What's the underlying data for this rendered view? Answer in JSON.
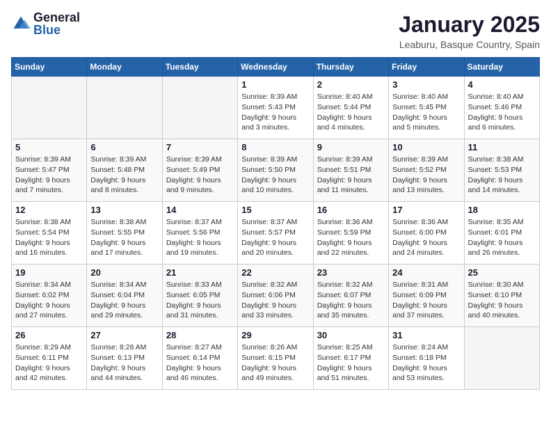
{
  "logo": {
    "general": "General",
    "blue": "Blue"
  },
  "title": "January 2025",
  "subtitle": "Leaburu, Basque Country, Spain",
  "weekdays": [
    "Sunday",
    "Monday",
    "Tuesday",
    "Wednesday",
    "Thursday",
    "Friday",
    "Saturday"
  ],
  "weeks": [
    [
      {
        "day": "",
        "info": ""
      },
      {
        "day": "",
        "info": ""
      },
      {
        "day": "",
        "info": ""
      },
      {
        "day": "1",
        "info": "Sunrise: 8:39 AM\nSunset: 5:43 PM\nDaylight: 9 hours and 3 minutes."
      },
      {
        "day": "2",
        "info": "Sunrise: 8:40 AM\nSunset: 5:44 PM\nDaylight: 9 hours and 4 minutes."
      },
      {
        "day": "3",
        "info": "Sunrise: 8:40 AM\nSunset: 5:45 PM\nDaylight: 9 hours and 5 minutes."
      },
      {
        "day": "4",
        "info": "Sunrise: 8:40 AM\nSunset: 5:46 PM\nDaylight: 9 hours and 6 minutes."
      }
    ],
    [
      {
        "day": "5",
        "info": "Sunrise: 8:39 AM\nSunset: 5:47 PM\nDaylight: 9 hours and 7 minutes."
      },
      {
        "day": "6",
        "info": "Sunrise: 8:39 AM\nSunset: 5:48 PM\nDaylight: 9 hours and 8 minutes."
      },
      {
        "day": "7",
        "info": "Sunrise: 8:39 AM\nSunset: 5:49 PM\nDaylight: 9 hours and 9 minutes."
      },
      {
        "day": "8",
        "info": "Sunrise: 8:39 AM\nSunset: 5:50 PM\nDaylight: 9 hours and 10 minutes."
      },
      {
        "day": "9",
        "info": "Sunrise: 8:39 AM\nSunset: 5:51 PM\nDaylight: 9 hours and 11 minutes."
      },
      {
        "day": "10",
        "info": "Sunrise: 8:39 AM\nSunset: 5:52 PM\nDaylight: 9 hours and 13 minutes."
      },
      {
        "day": "11",
        "info": "Sunrise: 8:38 AM\nSunset: 5:53 PM\nDaylight: 9 hours and 14 minutes."
      }
    ],
    [
      {
        "day": "12",
        "info": "Sunrise: 8:38 AM\nSunset: 5:54 PM\nDaylight: 9 hours and 16 minutes."
      },
      {
        "day": "13",
        "info": "Sunrise: 8:38 AM\nSunset: 5:55 PM\nDaylight: 9 hours and 17 minutes."
      },
      {
        "day": "14",
        "info": "Sunrise: 8:37 AM\nSunset: 5:56 PM\nDaylight: 9 hours and 19 minutes."
      },
      {
        "day": "15",
        "info": "Sunrise: 8:37 AM\nSunset: 5:57 PM\nDaylight: 9 hours and 20 minutes."
      },
      {
        "day": "16",
        "info": "Sunrise: 8:36 AM\nSunset: 5:59 PM\nDaylight: 9 hours and 22 minutes."
      },
      {
        "day": "17",
        "info": "Sunrise: 8:36 AM\nSunset: 6:00 PM\nDaylight: 9 hours and 24 minutes."
      },
      {
        "day": "18",
        "info": "Sunrise: 8:35 AM\nSunset: 6:01 PM\nDaylight: 9 hours and 26 minutes."
      }
    ],
    [
      {
        "day": "19",
        "info": "Sunrise: 8:34 AM\nSunset: 6:02 PM\nDaylight: 9 hours and 27 minutes."
      },
      {
        "day": "20",
        "info": "Sunrise: 8:34 AM\nSunset: 6:04 PM\nDaylight: 9 hours and 29 minutes."
      },
      {
        "day": "21",
        "info": "Sunrise: 8:33 AM\nSunset: 6:05 PM\nDaylight: 9 hours and 31 minutes."
      },
      {
        "day": "22",
        "info": "Sunrise: 8:32 AM\nSunset: 6:06 PM\nDaylight: 9 hours and 33 minutes."
      },
      {
        "day": "23",
        "info": "Sunrise: 8:32 AM\nSunset: 6:07 PM\nDaylight: 9 hours and 35 minutes."
      },
      {
        "day": "24",
        "info": "Sunrise: 8:31 AM\nSunset: 6:09 PM\nDaylight: 9 hours and 37 minutes."
      },
      {
        "day": "25",
        "info": "Sunrise: 8:30 AM\nSunset: 6:10 PM\nDaylight: 9 hours and 40 minutes."
      }
    ],
    [
      {
        "day": "26",
        "info": "Sunrise: 8:29 AM\nSunset: 6:11 PM\nDaylight: 9 hours and 42 minutes."
      },
      {
        "day": "27",
        "info": "Sunrise: 8:28 AM\nSunset: 6:13 PM\nDaylight: 9 hours and 44 minutes."
      },
      {
        "day": "28",
        "info": "Sunrise: 8:27 AM\nSunset: 6:14 PM\nDaylight: 9 hours and 46 minutes."
      },
      {
        "day": "29",
        "info": "Sunrise: 8:26 AM\nSunset: 6:15 PM\nDaylight: 9 hours and 49 minutes."
      },
      {
        "day": "30",
        "info": "Sunrise: 8:25 AM\nSunset: 6:17 PM\nDaylight: 9 hours and 51 minutes."
      },
      {
        "day": "31",
        "info": "Sunrise: 8:24 AM\nSunset: 6:18 PM\nDaylight: 9 hours and 53 minutes."
      },
      {
        "day": "",
        "info": ""
      }
    ]
  ]
}
